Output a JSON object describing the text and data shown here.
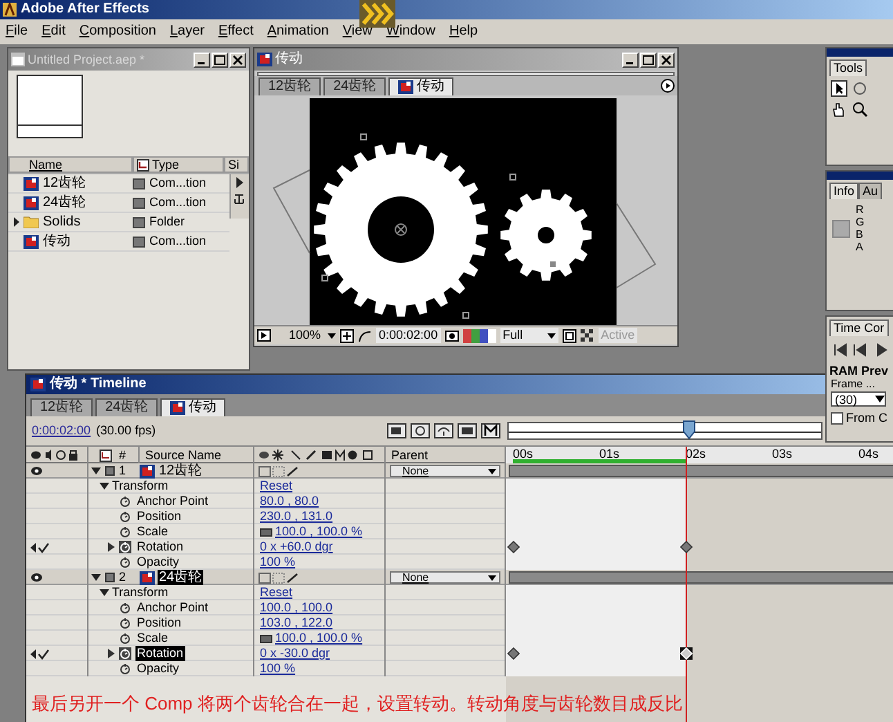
{
  "app": {
    "title": "Adobe After Effects"
  },
  "menu": [
    "File",
    "Edit",
    "Composition",
    "Layer",
    "Effect",
    "Animation",
    "View",
    "Window",
    "Help"
  ],
  "project": {
    "title": "Untitled Project.aep *",
    "columns": [
      "Name",
      "Type",
      "Si"
    ],
    "items": [
      {
        "kind": "comp",
        "name": "12齿轮",
        "type": "Com...tion"
      },
      {
        "kind": "comp",
        "name": "24齿轮",
        "type": "Com...tion"
      },
      {
        "kind": "folder",
        "name": "Solids",
        "type": "Folder"
      },
      {
        "kind": "comp",
        "name": "传动",
        "type": "Com...tion"
      }
    ]
  },
  "composition": {
    "title": "传动",
    "tabs": [
      {
        "label": "12齿轮",
        "selected": false
      },
      {
        "label": "24齿轮",
        "selected": false
      },
      {
        "label": "传动",
        "selected": true
      }
    ],
    "zoom": "100%",
    "time": "0:00:02:00",
    "resolution": "Full",
    "view": "Active"
  },
  "tools": {
    "tab": "Tools"
  },
  "info": {
    "tabs": [
      "Info",
      "Au"
    ],
    "channels": [
      "R",
      "G",
      "B",
      "A"
    ]
  },
  "time_controls": {
    "tab": "Time Cor",
    "section": "RAM Prev",
    "frame_label": "Frame ...",
    "frame_rate": "(30)",
    "from_current": {
      "label": "From C",
      "checked": false
    }
  },
  "timeline": {
    "title": "传动 * Timeline",
    "tabs": [
      {
        "label": "12齿轮",
        "selected": false
      },
      {
        "label": "24齿轮",
        "selected": false
      },
      {
        "label": "传动",
        "selected": true
      }
    ],
    "time": "0:00:02:00",
    "fps": "(30.00 fps)",
    "columns": {
      "number": "#",
      "source": "Source Name",
      "parent": "Parent"
    },
    "ruler": [
      "00s",
      "01s",
      "02s",
      "03s",
      "04s"
    ],
    "layers": [
      {
        "number": "1",
        "name": "12齿轮",
        "selected": false,
        "parent": "None",
        "group": "Transform",
        "reset": "Reset",
        "properties": [
          {
            "kind": "value",
            "name": "Anchor Point",
            "value": "80.0 , 80.0",
            "selected": false
          },
          {
            "kind": "value",
            "name": "Position",
            "value": "230.0 , 131.0",
            "selected": false
          },
          {
            "kind": "linked",
            "name": "Scale",
            "value": "100.0 , 100.0 %",
            "selected": false
          },
          {
            "kind": "value",
            "name": "Rotation",
            "value": "0 x +60.0 dgr",
            "selected": false,
            "keyframes": [
              {
                "selected": false
              },
              {
                "selected": false
              }
            ]
          },
          {
            "kind": "value",
            "name": "Opacity",
            "value": "100 %",
            "selected": false
          }
        ]
      },
      {
        "number": "2",
        "name": "24齿轮",
        "selected": true,
        "parent": "None",
        "group": "Transform",
        "reset": "Reset",
        "properties": [
          {
            "kind": "value",
            "name": "Anchor Point",
            "value": "100.0 , 100.0",
            "selected": false
          },
          {
            "kind": "value",
            "name": "Position",
            "value": "103.0 , 122.0",
            "selected": false
          },
          {
            "kind": "linked",
            "name": "Scale",
            "value": "100.0 , 100.0 %",
            "selected": false
          },
          {
            "kind": "value",
            "name": "Rotation",
            "value": "0 x -30.0 dgr",
            "selected": true,
            "keyframes": [
              {
                "selected": false
              },
              {
                "selected": true
              }
            ]
          },
          {
            "kind": "value",
            "name": "Opacity",
            "value": "100 %",
            "selected": false
          }
        ]
      }
    ]
  },
  "caption": "最后另开一个 Comp 将两个齿轮合在一起，设置转动。转动角度与齿轮数目成反比"
}
